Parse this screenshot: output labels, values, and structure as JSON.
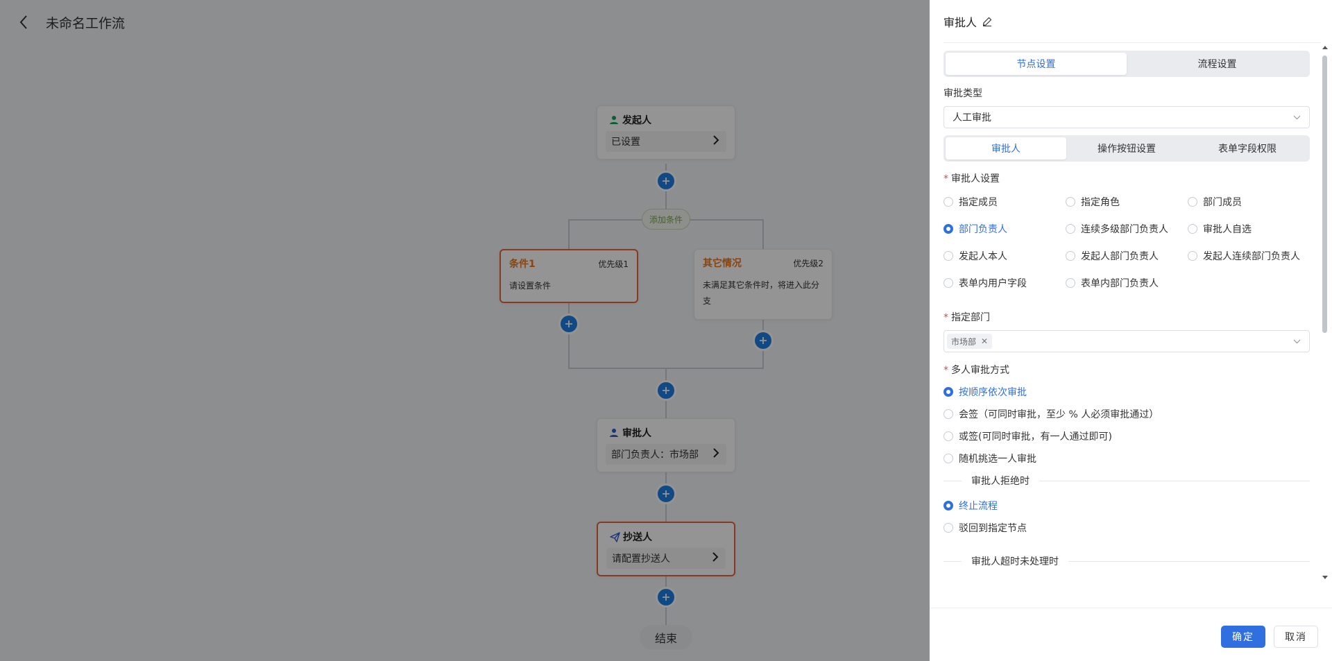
{
  "workflow": {
    "title": "未命名工作流",
    "back_icon": "chevron-left-icon"
  },
  "flow": {
    "initiator": {
      "title": "发起人",
      "value": "已设置",
      "icon": "user-icon",
      "icon_color": "#18a058"
    },
    "add_condition_label": "添加条件",
    "conditions": [
      {
        "name": "条件1",
        "priority": "优先级1",
        "desc": "请设置条件"
      },
      {
        "name": "其它情况",
        "priority": "优先级2",
        "desc": "未满足其它条件时，将进入此分支"
      }
    ],
    "approver": {
      "title": "审批人",
      "value": "部门负责人：市场部",
      "icon": "user-icon",
      "icon_color": "#2f5bd3"
    },
    "cc": {
      "title": "抄送人",
      "value": "请配置抄送人",
      "icon": "send-icon"
    },
    "end_label": "结束"
  },
  "drawer": {
    "title": "审批人",
    "tabs": [
      "节点设置",
      "流程设置"
    ],
    "approval_type_label": "审批类型",
    "approval_type_value": "人工审批",
    "sub_tabs": [
      "审批人",
      "操作按钮设置",
      "表单字段权限"
    ],
    "approver_setting_label": "审批人设置",
    "approver_options": [
      "指定成员",
      "指定角色",
      "部门成员",
      "部门负责人",
      "连续多级部门负责人",
      "审批人自选",
      "发起人本人",
      "发起人部门负责人",
      "发起人连续部门负责人",
      "表单内用户字段",
      "表单内部门负责人"
    ],
    "approver_selected": "部门负责人",
    "dept_label": "指定部门",
    "dept_tags": [
      "市场部"
    ],
    "multi_label": "多人审批方式",
    "multi_options": [
      "按顺序依次审批",
      "会签（可同时审批，至少 % 人必须审批通过）",
      "或签(可同时审批，有一人通过即可)",
      "随机挑选一人审批"
    ],
    "multi_selected": "按顺序依次审批",
    "reject_label": "审批人拒绝时",
    "reject_options": [
      "终止流程",
      "驳回到指定节点"
    ],
    "reject_selected": "终止流程",
    "timeout_label": "审批人超时未处理时",
    "ok_label": "确定",
    "cancel_label": "取消"
  },
  "colors": {
    "primary": "#2f6fe0",
    "warn_border": "#e8633a",
    "condition_name": "#e8781f",
    "plus_button": "#1e7fe6"
  }
}
